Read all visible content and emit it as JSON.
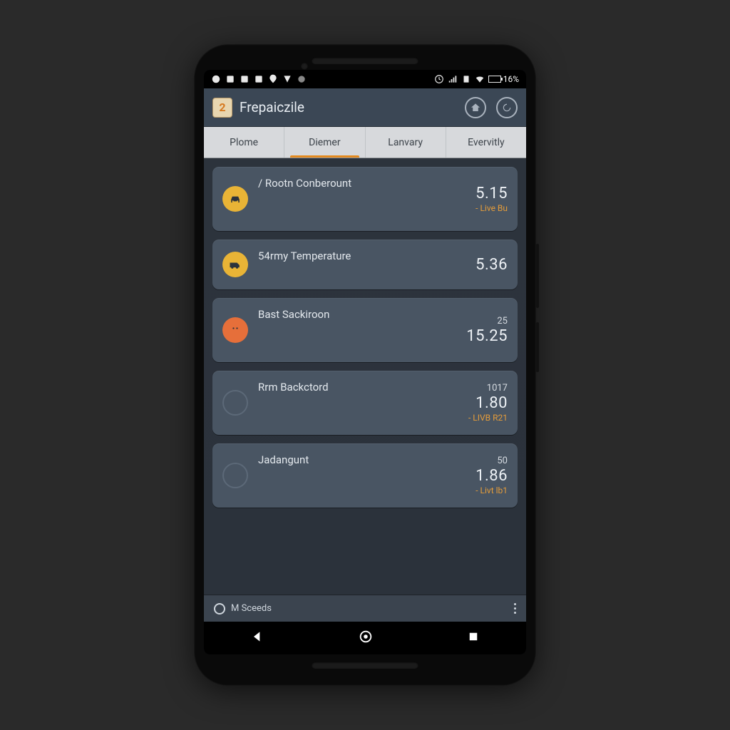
{
  "status": {
    "battery": "16%"
  },
  "app": {
    "icon_text": "2",
    "title": "Frepaiczile"
  },
  "tabs": [
    {
      "label": "Plome"
    },
    {
      "label": "Diemer",
      "active": true
    },
    {
      "label": "Lanvary"
    },
    {
      "label": "Evervitly"
    }
  ],
  "cards": [
    {
      "icon": "car",
      "icon_style": "yellow",
      "title": "/ Rootn Conberount",
      "top": "",
      "main": "5.15",
      "status": "- Live Bu"
    },
    {
      "icon": "van",
      "icon_style": "yellow",
      "title": "54rmy Temperature",
      "top": "",
      "main": "5.36",
      "status": ""
    },
    {
      "icon": "dot",
      "icon_style": "orange",
      "title": "Bast Sackiroon",
      "top": "25",
      "main": "15.25",
      "status": ""
    },
    {
      "icon": "none",
      "icon_style": "empty",
      "title": "Rrm Backctord",
      "top": "1017",
      "main": "1.80",
      "status": "- LIVB R21"
    },
    {
      "icon": "none",
      "icon_style": "empty",
      "title": "Jadangunt",
      "top": "50",
      "main": "1.86",
      "status": "- Livt lb1"
    }
  ],
  "footer": {
    "label": "M Sceeds"
  }
}
